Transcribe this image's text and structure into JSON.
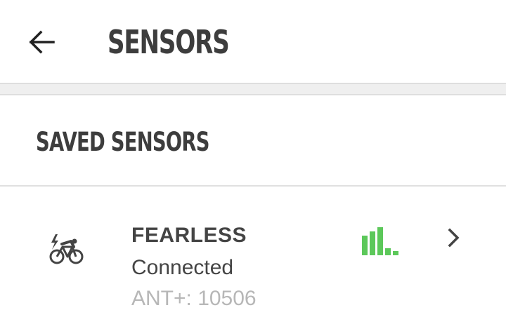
{
  "header": {
    "title": "SENSORS",
    "back_icon": "arrow-left-icon"
  },
  "section": {
    "title": "SAVED SENSORS"
  },
  "sensors": [
    {
      "name": "FEARLESS",
      "status": "Connected",
      "id_text": "ANT+: 10506",
      "type_icon": "e-bike-icon",
      "signal_icon": "signal-strength-icon",
      "signal_level": 0.6,
      "chevron_icon": "chevron-right-icon"
    }
  ],
  "colors": {
    "signal_active": "#5cc85a",
    "text_primary": "#444444",
    "text_muted": "#b7b7b7",
    "divider": "#e0e0e0"
  }
}
